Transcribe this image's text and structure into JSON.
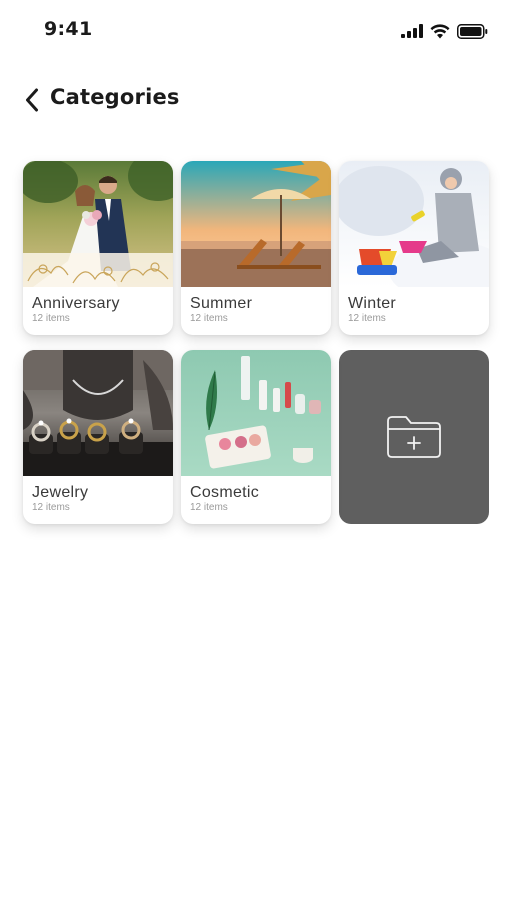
{
  "status_bar": {
    "time": "9:41",
    "icons": [
      "cellular-signal-icon",
      "wifi-icon",
      "battery-icon"
    ]
  },
  "header": {
    "back_icon": "chevron-left-icon",
    "title": "Categories"
  },
  "categories": [
    {
      "title": "Anniversary",
      "count": "12 items",
      "image": "wedding couple"
    },
    {
      "title": "Summer",
      "count": "12 items",
      "image": "beach with umbrella and lounge chairs"
    },
    {
      "title": "Winter",
      "count": "12 items",
      "image": "child playing in snow"
    },
    {
      "title": "Jewelry",
      "count": "12 items",
      "image": "rings on display"
    },
    {
      "title": "Cosmetic",
      "count": "12 items",
      "image": "cosmetics on mint background"
    }
  ],
  "add_card": {
    "icon": "add-folder-icon"
  },
  "colors": {
    "add_card_bg": "#5f5f5f",
    "title_text": "#3a3a3a",
    "count_text": "#9a9a9a"
  }
}
